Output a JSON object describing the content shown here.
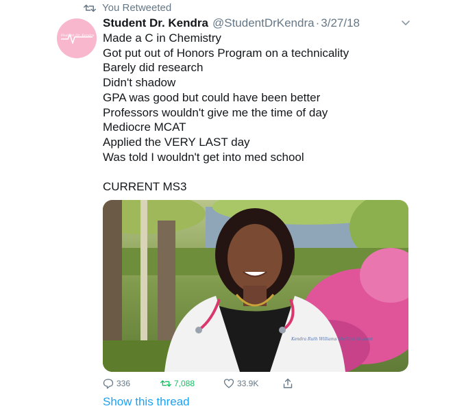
{
  "retweet_context": {
    "icon": "retweet-icon",
    "label": "You Retweeted"
  },
  "tweet": {
    "author_name": "Student Dr. Kendra",
    "handle": "@StudentDrKendra",
    "separator": "·",
    "date": "3/27/18",
    "avatar_caption": "Student Dr. Kendra",
    "text": "Made a C in Chemistry\nGot put out of Honors Program on a technicality\nBarely did research\nDidn't shadow\nGPA was good but could have been better\nProfessors wouldn't give me the time of day\nMediocre MCAT\nApplied the VERY LAST day\nWas told I wouldn't get into med school\n\nCURRENT MS3",
    "photo_badge_text": "Kendra Ruth Williams Medical Student"
  },
  "actions": {
    "reply_count": "336",
    "retweet_count": "7,088",
    "like_count": "33.9K"
  },
  "show_thread_label": "Show this thread",
  "colors": {
    "text": "#14171a",
    "muted": "#657786",
    "link": "#1da1f2",
    "retweeted": "#17bf63",
    "avatar_bg": "#f8b7cc"
  }
}
